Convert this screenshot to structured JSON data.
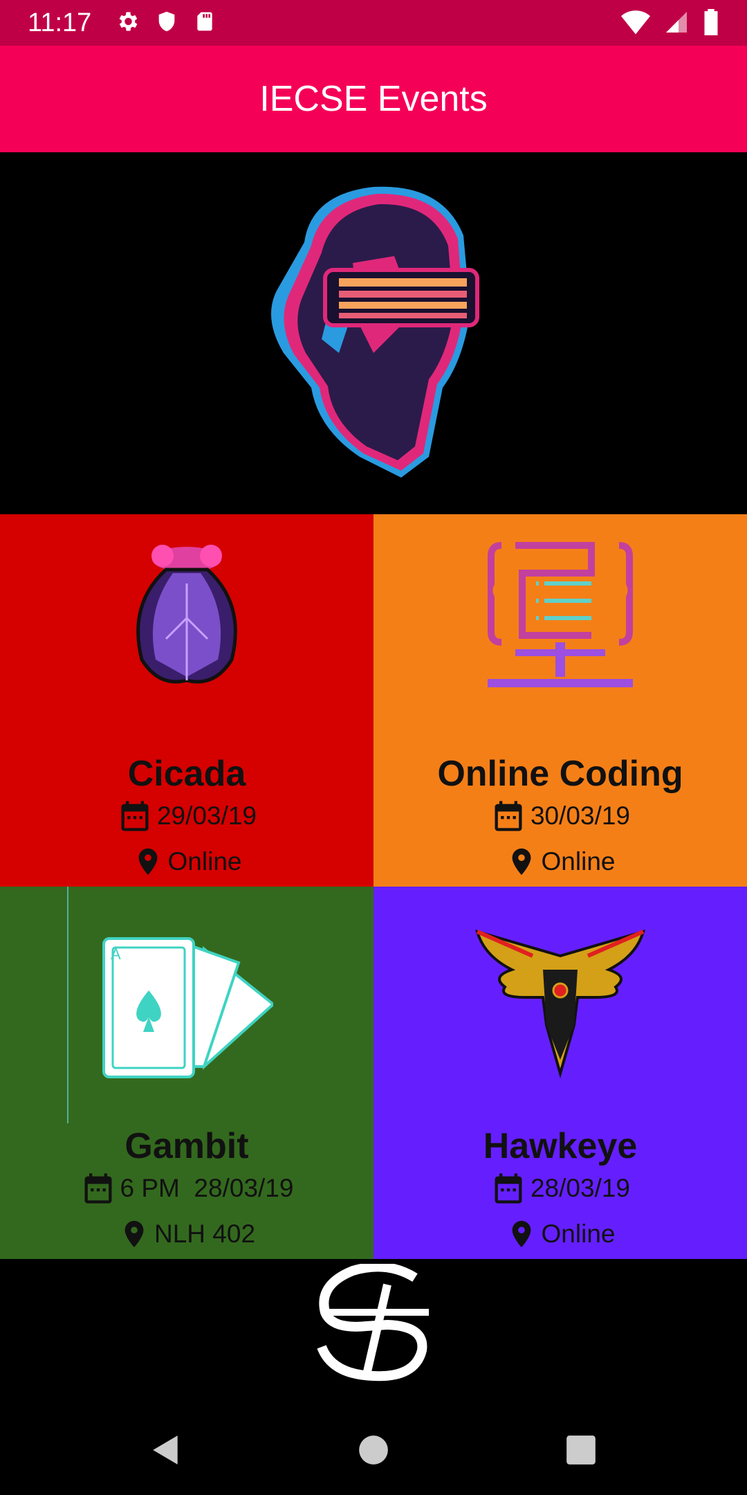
{
  "status_bar": {
    "time": "11:17",
    "left_icons": [
      "gear-icon",
      "shield-icon",
      "sd-card-icon"
    ],
    "right_icons": [
      "wifi-icon",
      "signal-icon",
      "battery-icon"
    ]
  },
  "app_bar": {
    "title": "IECSE Events",
    "color": "#F50057"
  },
  "events": [
    {
      "name": "Cicada",
      "date": "29/03/19",
      "venue": "Online",
      "color": "#D50000",
      "icon": "cicada-icon"
    },
    {
      "name": "Online Coding",
      "date": "30/03/19",
      "venue": "Online",
      "color": "#F57F17",
      "icon": "computer-code-icon"
    },
    {
      "name": "Gambit",
      "date": "6 PM  28/03/19",
      "venue": "NLH 402",
      "color": "#33691E",
      "icon": "playing-cards-icon"
    },
    {
      "name": "Hawkeye",
      "date": "28/03/19",
      "venue": "Online",
      "color": "#651FFF",
      "icon": "eagle-icon"
    }
  ],
  "footer": {
    "logo": "sponsor-logo-icon"
  },
  "nav": [
    "back-icon",
    "home-icon",
    "recents-icon"
  ]
}
